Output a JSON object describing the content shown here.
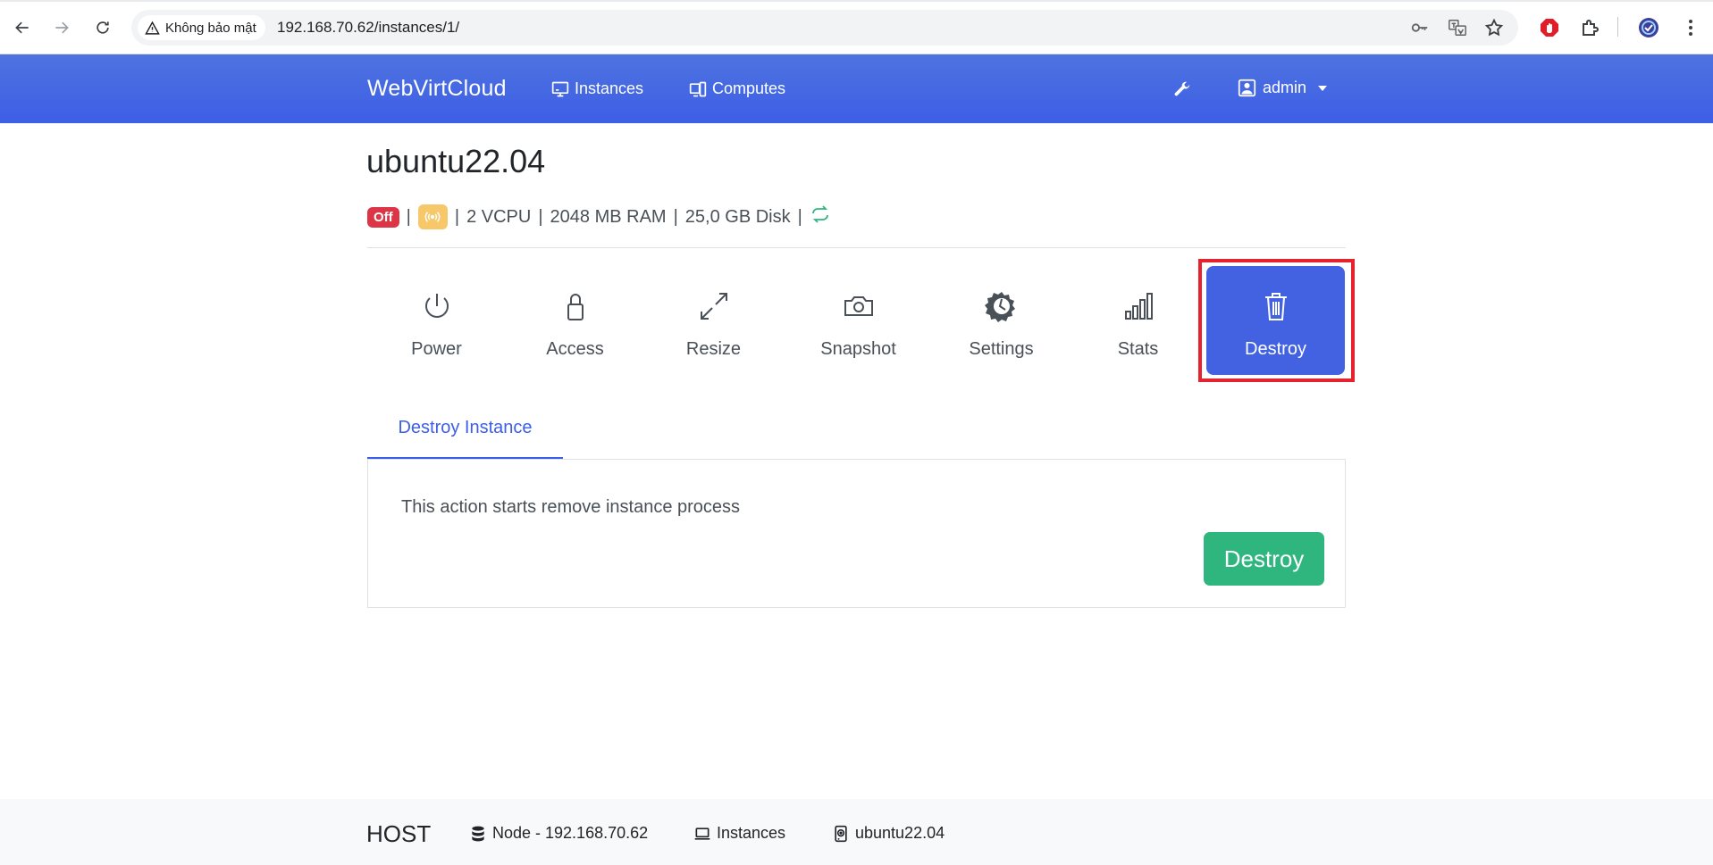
{
  "browser": {
    "security_label": "Không bảo mật",
    "url": "192.168.70.62/instances/1/"
  },
  "navbar": {
    "brand": "WebVirtCloud",
    "links": [
      {
        "label": "Instances",
        "icon": "monitor-icon"
      },
      {
        "label": "Computes",
        "icon": "devices-icon"
      }
    ],
    "user": "admin"
  },
  "instance": {
    "name": "ubuntu22.04",
    "status": "Off",
    "vcpu": "2 VCPU",
    "ram": "2048 MB RAM",
    "disk": "25,0 GB Disk"
  },
  "actions": [
    {
      "label": "Power",
      "icon": "power-icon"
    },
    {
      "label": "Access",
      "icon": "lock-icon"
    },
    {
      "label": "Resize",
      "icon": "resize-icon"
    },
    {
      "label": "Snapshot",
      "icon": "camera-icon"
    },
    {
      "label": "Settings",
      "icon": "gear-icon"
    },
    {
      "label": "Stats",
      "icon": "bar-chart-icon"
    },
    {
      "label": "Destroy",
      "icon": "trash-icon",
      "active": true
    }
  ],
  "destroy_panel": {
    "tab": "Destroy Instance",
    "message": "This action starts remove instance process",
    "button": "Destroy"
  },
  "footer": {
    "brand": "HOST",
    "crumbs": [
      {
        "label": "Node - 192.168.70.62",
        "icon": "database-icon"
      },
      {
        "label": "Instances",
        "icon": "laptop-icon"
      },
      {
        "label": "ubuntu22.04",
        "icon": "disk-icon"
      }
    ]
  },
  "colors": {
    "primary": "#3d5ee6",
    "success": "#2fb67f",
    "danger": "#dc3545",
    "warning": "#f6c86a",
    "highlight": "#e5222e"
  }
}
